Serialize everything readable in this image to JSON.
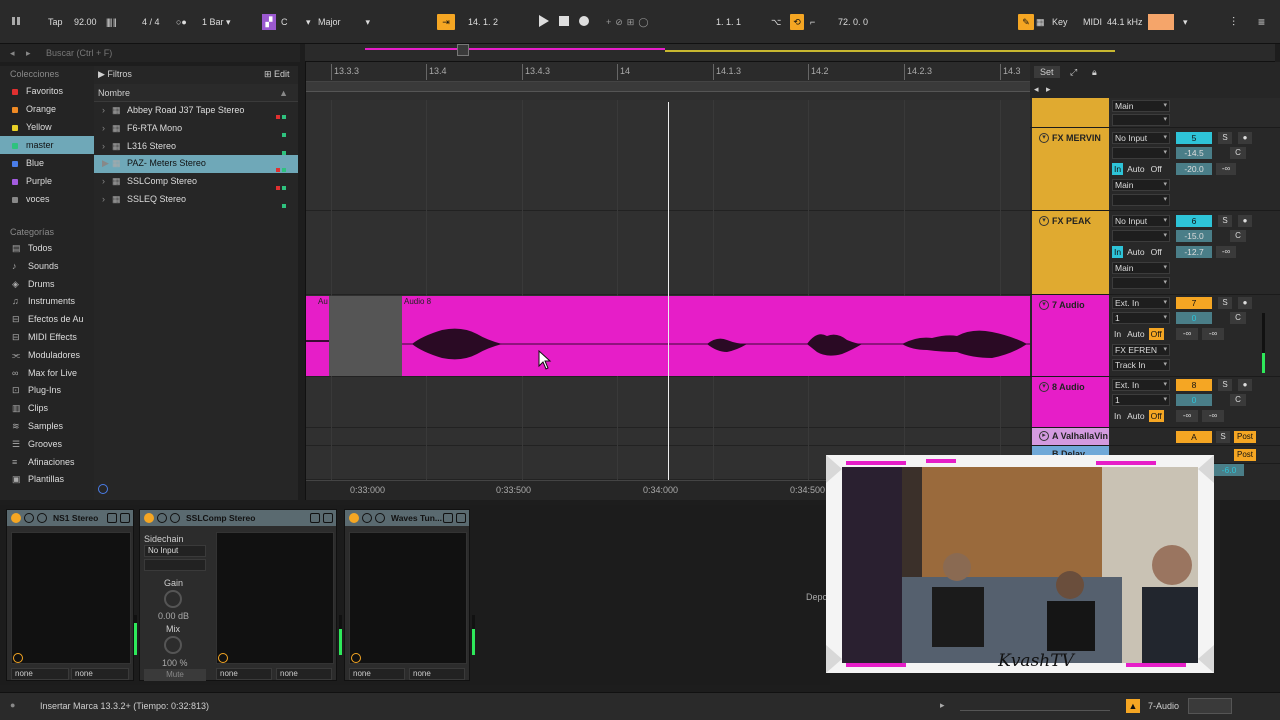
{
  "topbar": {
    "tap": "Tap",
    "tempo": "92.00",
    "time_sig": "4 / 4",
    "quantize": "1 Bar",
    "key_root": "C",
    "scale": "Major",
    "position": "14.  1.  2",
    "loop_start": "1.  1.  1",
    "loop_length": "72.  0.  0",
    "key_label": "Key",
    "midi_label": "MIDI",
    "sample_rate": "44.1 kHz"
  },
  "search": {
    "placeholder": "Buscar (Ctrl + F)"
  },
  "collections": {
    "title": "Colecciones",
    "items": [
      {
        "label": "Favoritos",
        "color": "#e03030"
      },
      {
        "label": "Orange",
        "color": "#f08a24"
      },
      {
        "label": "Yellow",
        "color": "#e8d027"
      },
      {
        "label": "master",
        "color": "#2ec27e"
      },
      {
        "label": "Blue",
        "color": "#4a7de8"
      },
      {
        "label": "Purple",
        "color": "#a45ce0"
      },
      {
        "label": "voces",
        "color": "#888888"
      }
    ]
  },
  "categories": {
    "title": "Categorías",
    "items": [
      {
        "label": "Todos",
        "icon": "library-icon"
      },
      {
        "label": "Sounds",
        "icon": "sounds-icon"
      },
      {
        "label": "Drums",
        "icon": "drums-icon"
      },
      {
        "label": "Instruments",
        "icon": "instrument-icon"
      },
      {
        "label": "Efectos de Au",
        "icon": "audio-fx-icon"
      },
      {
        "label": "MIDI Effects",
        "icon": "midi-fx-icon"
      },
      {
        "label": "Moduladores",
        "icon": "modulator-icon"
      },
      {
        "label": "Max for Live",
        "icon": "max-icon"
      },
      {
        "label": "Plug-Ins",
        "icon": "plugin-icon"
      },
      {
        "label": "Clips",
        "icon": "clip-icon"
      },
      {
        "label": "Samples",
        "icon": "sample-icon"
      },
      {
        "label": "Grooves",
        "icon": "groove-icon"
      },
      {
        "label": "Afinaciones",
        "icon": "tuning-icon"
      },
      {
        "label": "Plantillas",
        "icon": "template-icon"
      }
    ]
  },
  "filters": {
    "label": "Filtros",
    "edit": "Edit",
    "column": "Nombre"
  },
  "files": [
    {
      "label": "Abbey Road J37 Tape Stereo",
      "tags": [
        "#e03030",
        "#2ec27e"
      ]
    },
    {
      "label": "F6-RTA Mono",
      "tags": [
        "#2ec27e"
      ]
    },
    {
      "label": "L316 Stereo",
      "tags": [
        "#2ec27e"
      ]
    },
    {
      "label": "PAZ- Meters Stereo",
      "tags": [
        "#e03030",
        "#2ec27e"
      ]
    },
    {
      "label": "SSLComp Stereo",
      "tags": [
        "#e03030",
        "#2ec27e"
      ]
    },
    {
      "label": "SSLEQ Stereo",
      "tags": [
        "#2ec27e"
      ]
    }
  ],
  "ruler": {
    "labels": [
      "13.3.3",
      "13.4",
      "13.4.3",
      "14",
      "14.1.3",
      "14.2",
      "14.2.3",
      "14.3"
    ],
    "set_label": "Set"
  },
  "timeline": {
    "labels": [
      "0:33:000",
      "0:33:500",
      "0:34:000",
      "0:34:500"
    ]
  },
  "clips": {
    "short_label": "Au",
    "main_label": "Audio 8"
  },
  "tracks": [
    {
      "name": "",
      "io": "Main"
    },
    {
      "name": "FX MERVIN",
      "input": "No Input",
      "number": "5",
      "vol": "-14.5",
      "pan": "C",
      "send": "-20.0",
      "send2": "-∞",
      "out": "Main",
      "color": "#e0aa30"
    },
    {
      "name": "FX PEAK",
      "input": "No Input",
      "number": "6",
      "vol": "-15.0",
      "pan": "C",
      "send": "-12.7",
      "send2": "-∞",
      "out": "Main",
      "color": "#e0aa30"
    },
    {
      "name": "7 Audio",
      "input": "Ext. In",
      "channel": "1",
      "number": "7",
      "vol": "0",
      "pan": "C",
      "send": "-∞",
      "send2": "-∞",
      "route": "FX EFREN",
      "route2": "Track In",
      "color": "#e61ec8"
    },
    {
      "name": "8 Audio",
      "input": "Ext. In",
      "channel": "1",
      "number": "8",
      "vol": "0",
      "pan": "C",
      "send": "-∞",
      "send2": "-∞",
      "color": "#e61ec8"
    },
    {
      "name": "A ValhallaVin",
      "number": "A",
      "post": "Post"
    },
    {
      "name": "B Delay",
      "post": "Post",
      "vol": "-6.0"
    }
  ],
  "monitor": {
    "in": "In",
    "auto": "Auto",
    "off": "Off",
    "solo": "S"
  },
  "devices": [
    {
      "name": "NS1 Stereo",
      "sel1": "none",
      "sel2": "none"
    },
    {
      "name": "SSLComp Stereo",
      "sidechain": "Sidechain",
      "sc_input": "No Input",
      "gain": "Gain",
      "gain_val": "0.00 dB",
      "mix": "Mix",
      "mix_val": "100 %",
      "mute": "Mute",
      "sel1": "none",
      "sel2": "none"
    },
    {
      "name": "Waves Tun...",
      "sel1": "none",
      "sel2": "none"
    }
  ],
  "drop_hint": "Depo",
  "webcam": {
    "name": "KvashTV"
  },
  "status": {
    "text": "Insertar Marca 13.3.2+ (Tiempo: 0:32:813)",
    "track": "7-Audio"
  }
}
